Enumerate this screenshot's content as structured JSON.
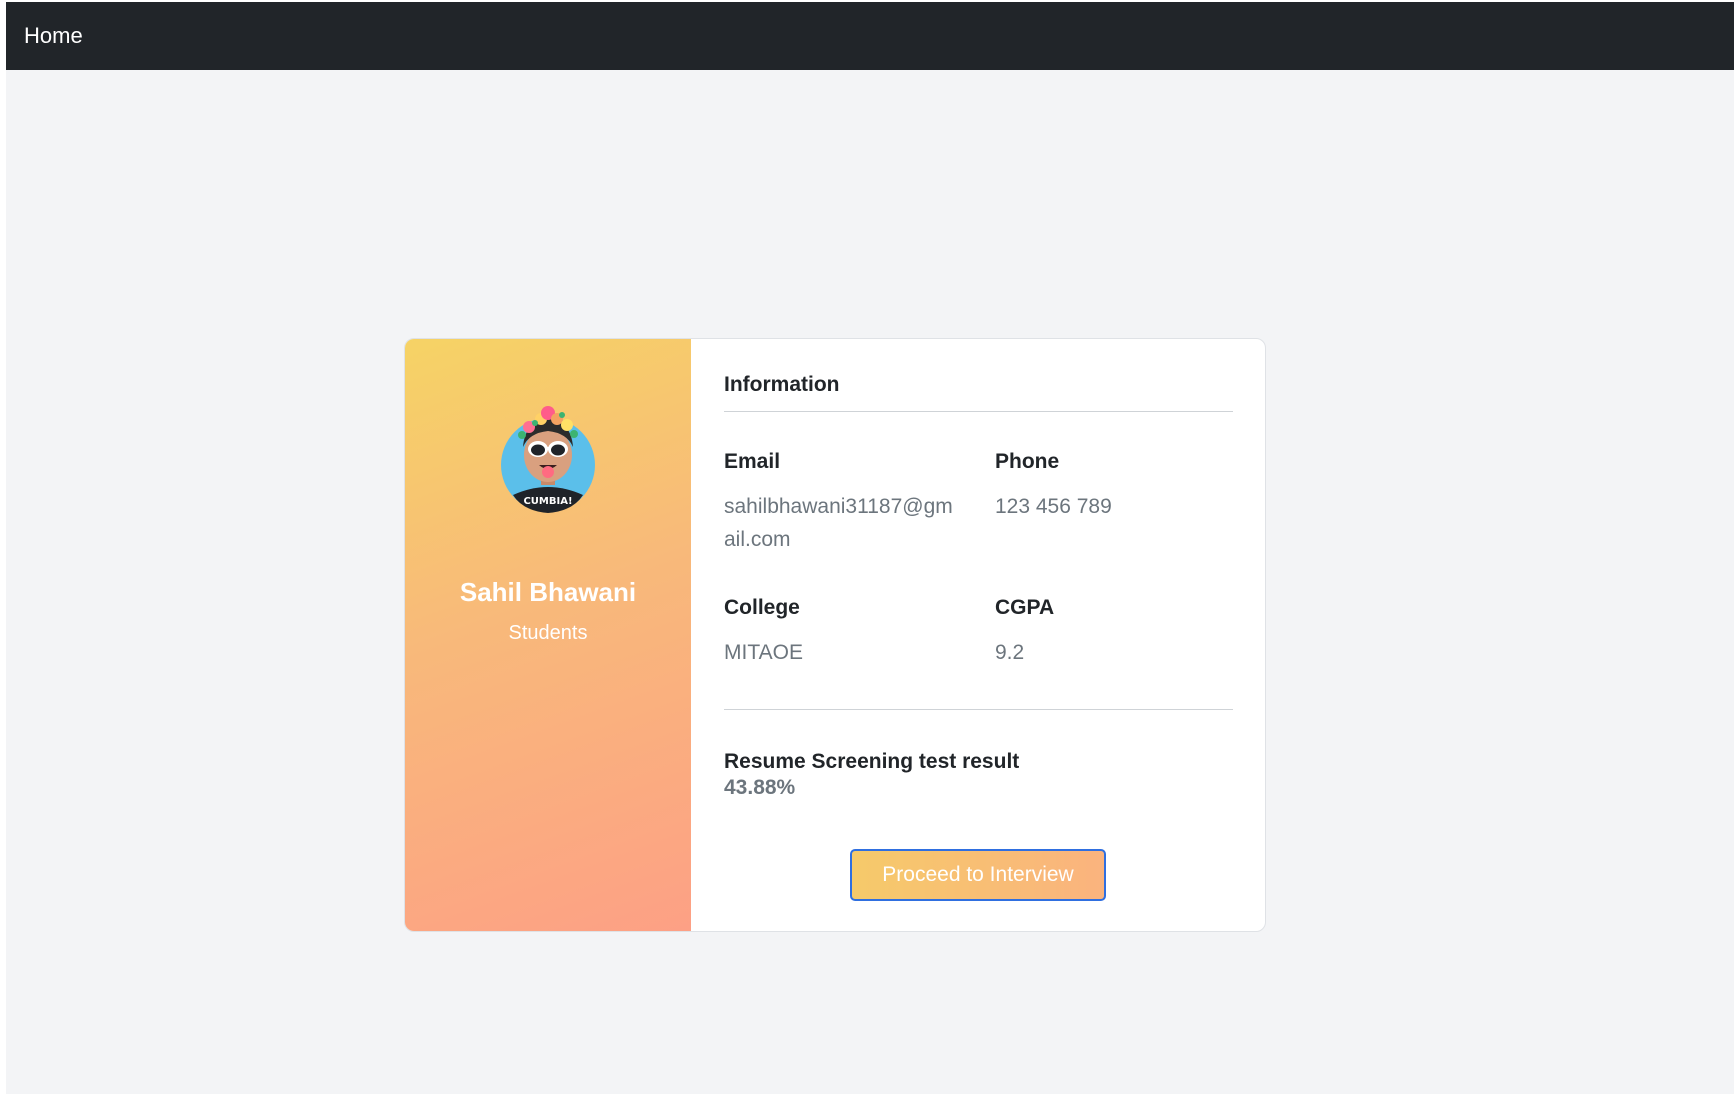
{
  "navbar": {
    "brand": "Home"
  },
  "profile": {
    "name": "Sahil Bhawani",
    "role": "Students",
    "avatar_text": "CUMBIA!"
  },
  "information": {
    "title": "Information",
    "email": {
      "label": "Email",
      "value": "sahilbhawani31187@gmail.com"
    },
    "phone": {
      "label": "Phone",
      "value": "123 456 789"
    },
    "college": {
      "label": "College",
      "value": "MITAOE"
    },
    "cgpa": {
      "label": "CGPA",
      "value": "9.2"
    }
  },
  "result": {
    "label": "Resume Screening test result",
    "value": "43.88%"
  },
  "actions": {
    "proceed_label": "Proceed to Interview"
  },
  "colors": {
    "navbar": "#212529",
    "gradient_start": "#f6d365",
    "gradient_end": "#fda085",
    "button_border": "#2f6fe0"
  }
}
